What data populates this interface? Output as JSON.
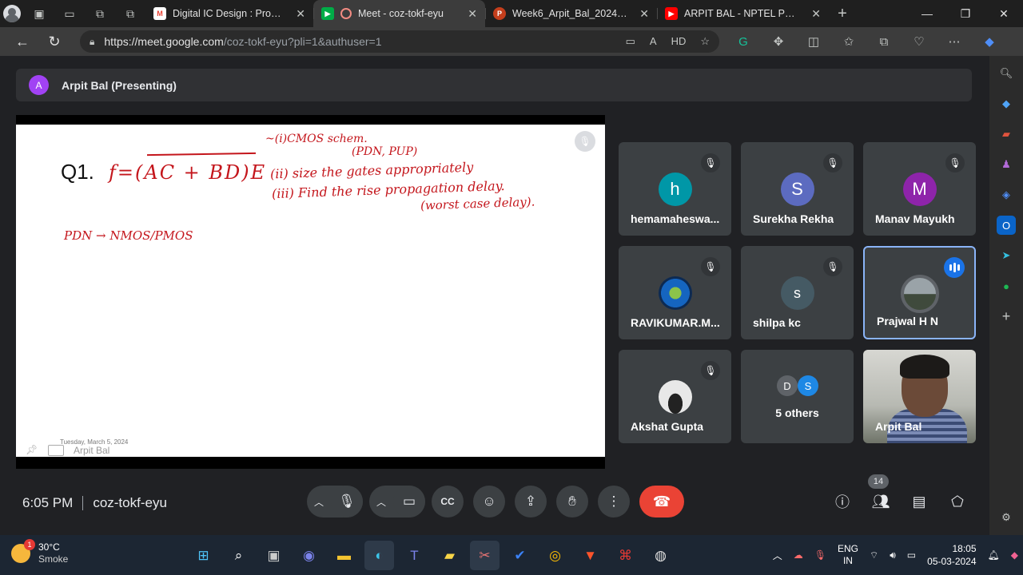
{
  "browser": {
    "tabs": [
      {
        "title": "Digital IC Design : Problem s",
        "favicon": "gmail-icon",
        "color": "#ea4335",
        "active": false
      },
      {
        "title": "Meet - coz-tokf-eyu",
        "favicon": "meet-icon",
        "color": "#00ac47",
        "active": true
      },
      {
        "title": "Week6_Arpit_Bal_2024_p1.p",
        "favicon": "powerpoint-icon",
        "color": "#c43e1c",
        "active": false
      },
      {
        "title": "ARPIT BAL - NPTEL PMRF TA",
        "favicon": "youtube-icon",
        "color": "#ff0000",
        "active": false
      }
    ],
    "url_host": "https://meet.google.com",
    "url_rest": "/coz-tokf-eyu?pli=1&authuser=1"
  },
  "meet": {
    "presenter_initial": "A",
    "presenting_label": "Arpit Bal (Presenting)",
    "slide": {
      "q1": "Q1.",
      "equation": "f=(AC + BD)E",
      "item1": "~(i)CMOS schem.",
      "item1b": "(PDN, PUP)",
      "item2": "(ii) size the gates appropriately",
      "item3": "(iii) Find the rise propagation delay.",
      "item3b": "(worst case delay).",
      "pdn_note": "PDN → NMOS/PMOS",
      "date": "Tuesday, March 5, 2024",
      "footer_name": "Arpit Bal"
    },
    "participants": [
      {
        "name": "hemamaheswa...",
        "initial": "h",
        "color": "#0097a7",
        "muted": true
      },
      {
        "name": "Surekha Rekha",
        "initial": "S",
        "color": "#5c6bc0",
        "muted": true
      },
      {
        "name": "Manav Mayukh",
        "initial": "M",
        "color": "#8e24aa",
        "muted": true
      },
      {
        "name": "RAVIKUMAR.M...",
        "initial": "",
        "color": "#1565c0",
        "muted": true
      },
      {
        "name": "shilpa kc",
        "initial": "s",
        "color": "#455a64",
        "muted": true
      },
      {
        "name": "Prajwal H N",
        "initial": "",
        "color": "#4e5b5e",
        "speaking": true
      },
      {
        "name": "Akshat Gupta",
        "initial": "",
        "color": "#e0e0e0",
        "muted": true
      },
      {
        "name": "5 others",
        "initials": [
          "D",
          "S"
        ],
        "colors": [
          "#5f6368",
          "#1e88e5"
        ]
      },
      {
        "name": "Arpit Bal",
        "video": true
      }
    ],
    "time": "6:05 PM",
    "meeting_code": "coz-tokf-eyu",
    "people_count": "14"
  },
  "taskbar": {
    "temp": "30°C",
    "weather": "Smoke",
    "weather_badge": "1",
    "lang1": "ENG",
    "lang2": "IN",
    "clock_time": "18:05",
    "clock_date": "05-03-2024"
  }
}
